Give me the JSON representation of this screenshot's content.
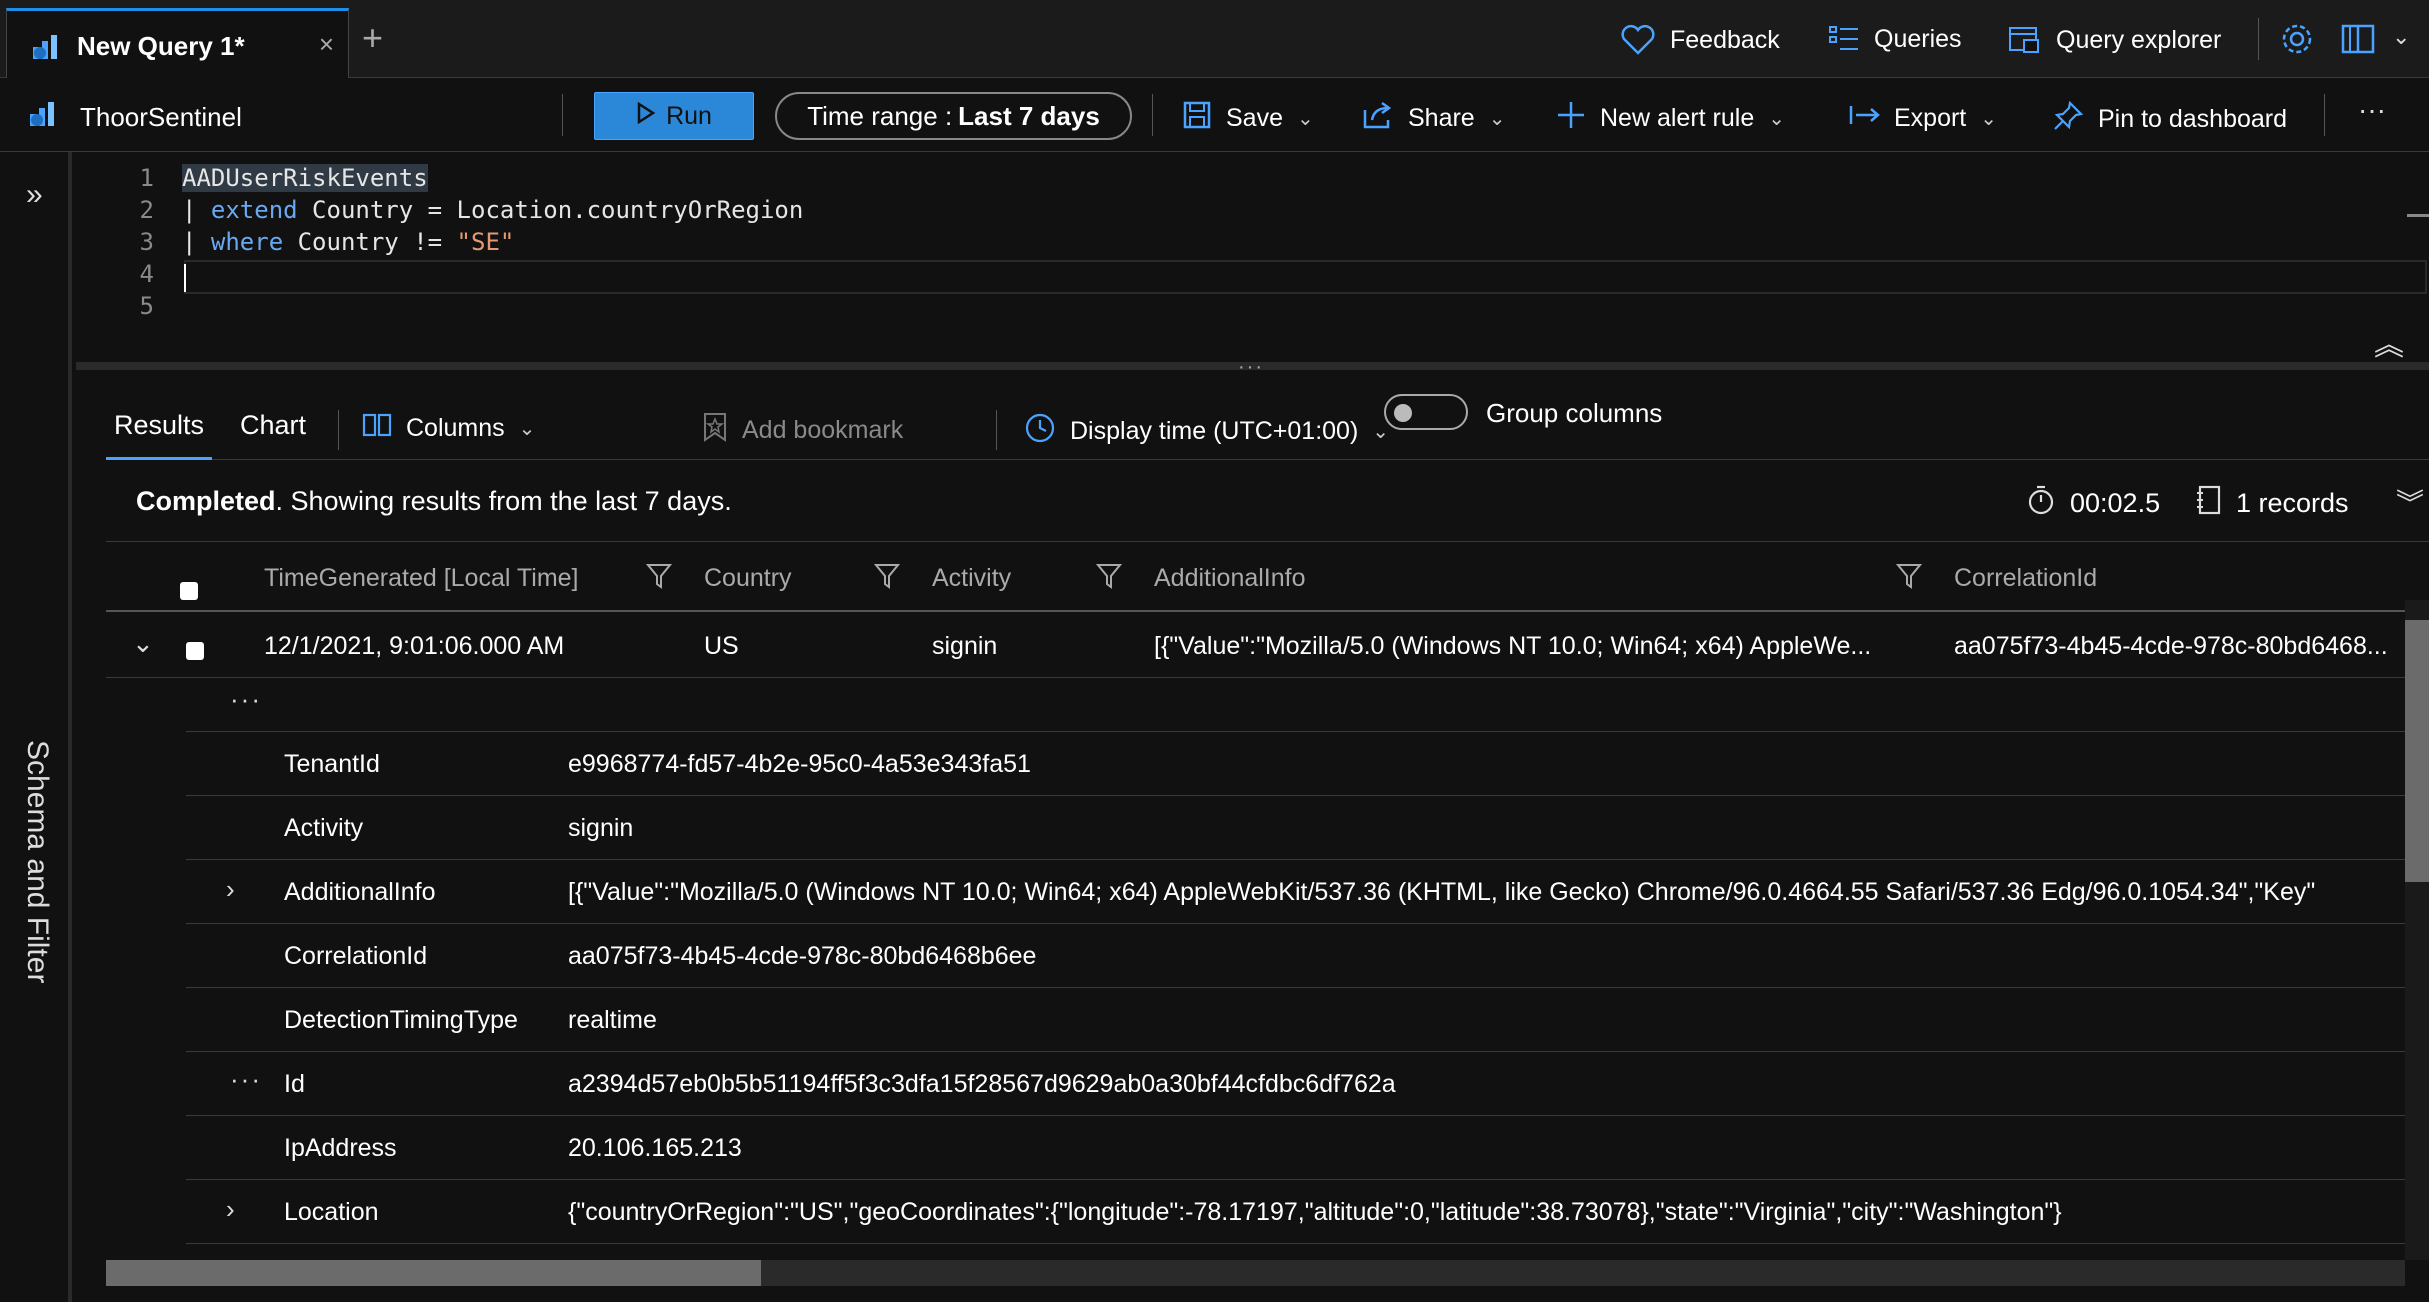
{
  "tabs": {
    "active_label": "New Query 1*",
    "close_glyph": "×",
    "new_glyph": "+"
  },
  "top_actions": {
    "feedback": "Feedback",
    "queries": "Queries",
    "query_explorer": "Query explorer"
  },
  "command_bar": {
    "workspace": "ThoorSentinel",
    "run": "Run",
    "time_range_label": "Time range :",
    "time_range_value": "Last 7 days",
    "save": "Save",
    "share": "Share",
    "new_alert_rule": "New alert rule",
    "export": "Export",
    "pin": "Pin to dashboard",
    "more": "···"
  },
  "rail": {
    "expand": "»",
    "label": "Schema and Filter"
  },
  "editor": {
    "line_numbers": [
      "1",
      "2",
      "3",
      "4",
      "5"
    ],
    "line1": "AADUserRiskEvents",
    "line2_pipe": "| ",
    "line2_kw": "extend",
    "line2_rest": " Country = Location.countryOrRegion",
    "line3_pipe": "| ",
    "line3_kw": "where",
    "line3_rest": " Country != ",
    "line3_str": "\"SE\""
  },
  "results_tabs": {
    "results": "Results",
    "chart": "Chart",
    "columns": "Columns",
    "add_bookmark": "Add bookmark",
    "display_time": "Display time (UTC+01:00)",
    "group_columns": "Group columns"
  },
  "status": {
    "completed": "Completed",
    "message": ". Showing results from the last 7 days.",
    "elapsed": "00:02.5",
    "records": "1 records"
  },
  "grid": {
    "columns": [
      "TimeGenerated [Local Time]",
      "Country",
      "Activity",
      "AdditionalInfo",
      "CorrelationId"
    ],
    "row": {
      "time": "12/1/2021, 9:01:06.000 AM",
      "country": "US",
      "activity": "signin",
      "additional_info": "[{\"Value\":\"Mozilla/5.0 (Windows NT 10.0; Win64; x64) AppleWe...",
      "correlation_id": "aa075f73-4b45-4cde-978c-80bd6468..."
    },
    "details": [
      {
        "key": "TenantId",
        "value": "e9968774-fd57-4b2e-95c0-4a53e343fa51"
      },
      {
        "key": "Activity",
        "value": "signin"
      },
      {
        "key": "AdditionalInfo",
        "value": "[{\"Value\":\"Mozilla/5.0 (Windows NT 10.0; Win64; x64) AppleWebKit/537.36 (KHTML, like Gecko) Chrome/96.0.4664.55 Safari/537.36 Edg/96.0.1054.34\",\"Key\""
      },
      {
        "key": "CorrelationId",
        "value": "aa075f73-4b45-4cde-978c-80bd6468b6ee"
      },
      {
        "key": "DetectionTimingType",
        "value": "realtime"
      },
      {
        "key": "Id",
        "value": "a2394d57eb0b5b51194ff5f3c3dfa15f28567d9629ab0a30bf44cfdbc6df762a"
      },
      {
        "key": "IpAddress",
        "value": "20.106.165.213"
      },
      {
        "key": "Location",
        "value": "{\"countryOrRegion\":\"US\",\"geoCoordinates\":{\"longitude\":-78.17197,\"altitude\":0,\"latitude\":38.73078},\"state\":\"Virginia\",\"city\":\"Washington\"}"
      }
    ]
  },
  "colors": {
    "accent": "#4aa3ff",
    "run_button": "#2b88d8",
    "background": "#111111"
  },
  "icons": [
    "logs-icon",
    "heart-icon",
    "queries-icon",
    "query-explorer-icon",
    "gear-icon",
    "book-icon",
    "chevron-down-icon",
    "play-icon",
    "save-icon",
    "share-icon",
    "plus-icon",
    "export-icon",
    "pin-icon",
    "columns-icon",
    "bookmark-icon",
    "clock-icon",
    "stopwatch-icon",
    "notebook-icon",
    "filter-icon"
  ]
}
